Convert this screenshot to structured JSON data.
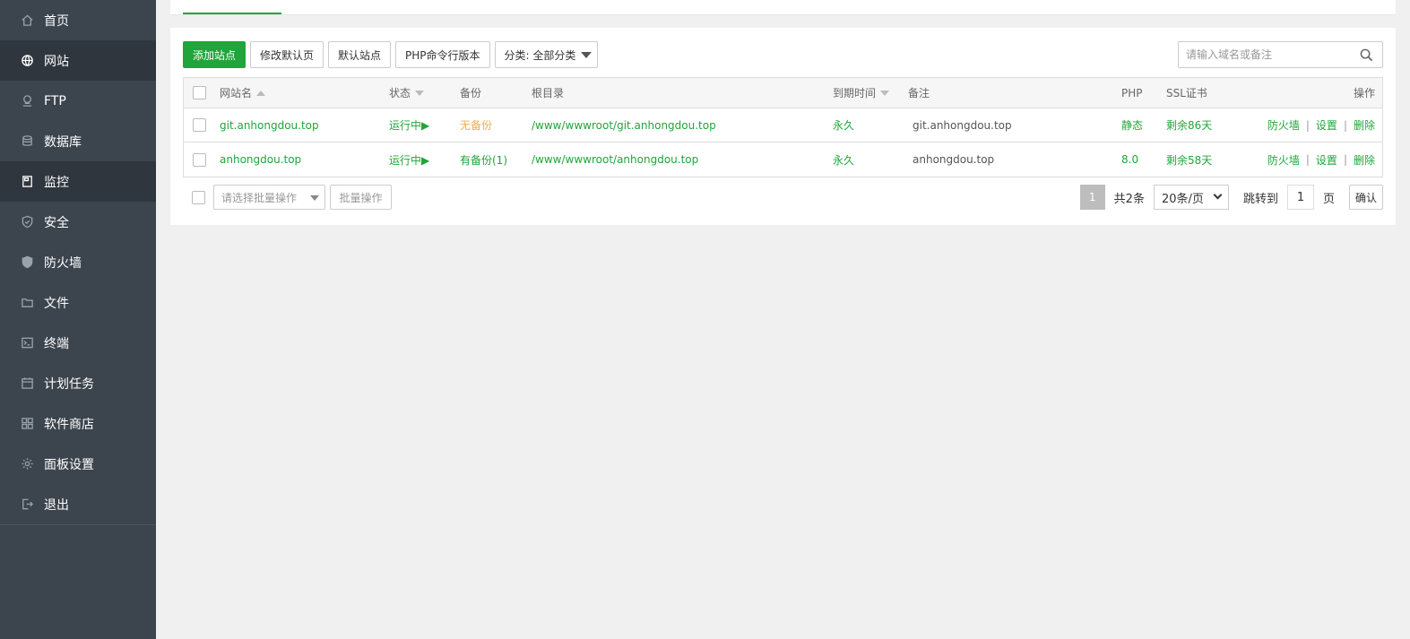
{
  "sidebar": {
    "items": [
      {
        "label": "首页",
        "icon": "home-icon"
      },
      {
        "label": "网站",
        "icon": "globe-icon",
        "active": true
      },
      {
        "label": "FTP",
        "icon": "ftp-icon"
      },
      {
        "label": "数据库",
        "icon": "database-icon"
      },
      {
        "label": "监控",
        "icon": "monitor-icon",
        "active": true
      },
      {
        "label": "安全",
        "icon": "shield-icon"
      },
      {
        "label": "防火墙",
        "icon": "firewall-icon"
      },
      {
        "label": "文件",
        "icon": "folder-icon"
      },
      {
        "label": "终端",
        "icon": "terminal-icon"
      },
      {
        "label": "计划任务",
        "icon": "calendar-icon"
      },
      {
        "label": "软件商店",
        "icon": "apps-icon"
      },
      {
        "label": "面板设置",
        "icon": "gear-icon"
      },
      {
        "label": "退出",
        "icon": "logout-icon"
      }
    ]
  },
  "toolbar": {
    "add_site": "添加站点",
    "edit_default_page": "修改默认页",
    "default_site": "默认站点",
    "php_cli_version": "PHP命令行版本",
    "category": "分类: 全部分类"
  },
  "search": {
    "placeholder": "请输入域名或备注"
  },
  "table": {
    "headers": {
      "site_name": "网站名",
      "status": "状态",
      "backup": "备份",
      "root_dir": "根目录",
      "expire": "到期时间",
      "remark": "备注",
      "php": "PHP",
      "ssl": "SSL证书",
      "actions": "操作"
    },
    "rows": [
      {
        "site_name": "git.anhongdou.top",
        "status": "运行中▶",
        "backup": "无备份",
        "root_dir": "/www/wwwroot/git.anhongdou.top",
        "expire": "永久",
        "remark": "git.anhongdou.top",
        "php": "静态",
        "ssl": "剩余86天",
        "action_firewall": "防火墙",
        "action_settings": "设置",
        "action_delete": "删除"
      },
      {
        "site_name": "anhongdou.top",
        "status": "运行中▶",
        "backup": "有备份(1)",
        "root_dir": "/www/wwwroot/anhongdou.top",
        "expire": "永久",
        "remark": "anhongdou.top",
        "php": "8.0",
        "ssl": "剩余58天",
        "action_firewall": "防火墙",
        "action_settings": "设置",
        "action_delete": "删除"
      }
    ],
    "action_separator": "|"
  },
  "footer": {
    "batch_placeholder": "请选择批量操作",
    "batch_button": "批量操作",
    "current_page": "1",
    "total": "共2条",
    "page_size": "20条/页",
    "jump_label": "跳转到",
    "jump_value": "1",
    "page_unit": "页",
    "confirm": "确认"
  },
  "colors": {
    "accent": "#20a53a",
    "sidebar_bg": "#3c444d",
    "sidebar_active": "#2f363e",
    "warning": "#f0ad4e"
  }
}
